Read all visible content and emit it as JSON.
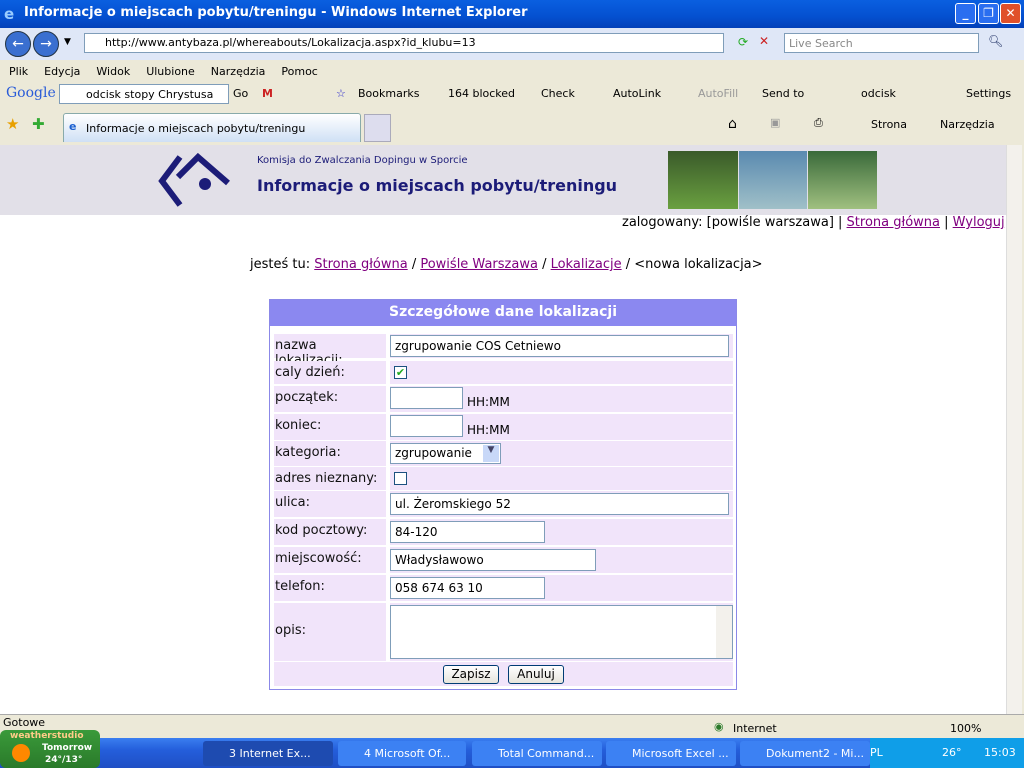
{
  "window": {
    "title": "Informacje o miejscach pobytu/treningu - Windows Internet Explorer"
  },
  "address": {
    "url": "http://www.antybaza.pl/whereabouts/Lokalizacja.aspx?id_klubu=13",
    "search_placeholder": "Live Search"
  },
  "menu": [
    "Plik",
    "Edycja",
    "Widok",
    "Ulubione",
    "Narzędzia",
    "Pomoc"
  ],
  "google_toolbar": {
    "logo": "Google",
    "query": "odcisk stopy Chrystusa",
    "go": "Go",
    "bookmarks": "Bookmarks",
    "blocked": "164 blocked",
    "check": "Check",
    "autolink": "AutoLink",
    "autofill": "AutoFill",
    "sendto": "Send to",
    "odcisk": "odcisk",
    "settings": "Settings"
  },
  "tab": {
    "label": "Informacje o miejscach pobytu/treningu"
  },
  "command_bar": {
    "page": "Strona",
    "tools": "Narzędzia"
  },
  "banner": {
    "org": "Komisja do Zwalczania Dopingu w Sporcie",
    "title": "Informacje o miejscach pobytu/treningu"
  },
  "user": {
    "prefix": "zalogowany:",
    "name": "[powiśle warszawa]",
    "home": "Strona główna",
    "logout": "Wyloguj"
  },
  "breadcrumb": {
    "prefix": "jesteś tu:",
    "items": [
      "Strona główna",
      "Powiśle Warszawa",
      "Lokalizacje"
    ],
    "current": "<nowa lokalizacja>"
  },
  "form": {
    "title": "Szczegółowe dane lokalizacji",
    "name_label": "nazwa lokalizacji:",
    "name_value": "zgrupowanie COS Cetniewo",
    "allday_label": "caly dzień:",
    "allday_checked": true,
    "start_label": "początek:",
    "start_value": "",
    "end_label": "koniec:",
    "end_value": "",
    "time_hint": "HH:MM",
    "category_label": "kategoria:",
    "category_value": "zgrupowanie",
    "unknown_label": "adres nieznany:",
    "unknown_checked": false,
    "street_label": "ulica:",
    "street_value": "ul. Żeromskiego 52",
    "zip_label": "kod pocztowy:",
    "zip_value": "84-120",
    "city_label": "miejscowość:",
    "city_value": "Władysławowo",
    "phone_label": "telefon:",
    "phone_value": "058 674 63 10",
    "desc_label": "opis:",
    "desc_value": "",
    "save": "Zapisz",
    "cancel": "Anuluj"
  },
  "status": {
    "text": "Gotowe",
    "zone": "Internet",
    "zoom": "100%"
  },
  "taskbar": {
    "weather_brand": "weatherstudio",
    "weather_day": "Tomorrow",
    "weather_temp": "24°/13°",
    "tasks": [
      "3 Internet Ex...",
      "4 Microsoft Of...",
      "Total Command...",
      "Microsoft Excel ...",
      "Dokument2 - Mi..."
    ],
    "lang": "PL",
    "temp": "26°",
    "clock": "15:03"
  }
}
